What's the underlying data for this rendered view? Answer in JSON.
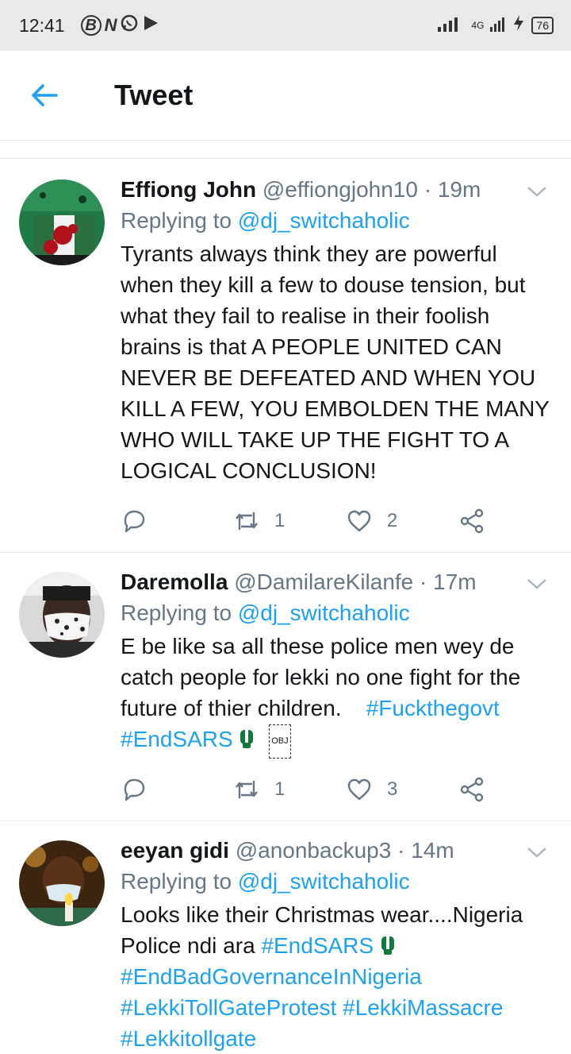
{
  "status_bar": {
    "time": "12:41",
    "network": "4G",
    "battery": "76",
    "icons": [
      "b-circle-icon",
      "n-icon",
      "whatsapp-icon",
      "play-icon",
      "signal-icon",
      "charging-icon"
    ]
  },
  "app_bar": {
    "title": "Tweet",
    "back_icon": "back-arrow-icon"
  },
  "colors": {
    "accent": "#1da1f2",
    "secondary_text": "#657786",
    "primary_text": "#14171a",
    "divider": "#e1e8ed",
    "status_bar": "#e9e9e9"
  },
  "tweets": [
    {
      "display_name": "Effiong John",
      "handle": "@effiongjohn10",
      "separator": "·",
      "time": "19m",
      "replying_prefix": "Replying to",
      "replying_to": "@dj_switchaholic",
      "text": "Tyrants always think they are powerful when they kill a few to douse tension, but what they fail to realise in their foolish brains is that A PEOPLE UNITED CAN NEVER BE DEFEATED AND WHEN YOU KILL A FEW, YOU EMBOLDEN THE MANY WHO WILL TAKE UP THE FIGHT TO A LOGICAL CONCLUSION!",
      "retweets": "1",
      "likes": "2"
    },
    {
      "display_name": "Daremolla",
      "handle": "@DamilareKilanfe",
      "separator": "·",
      "time": "17m",
      "replying_prefix": "Replying to",
      "replying_to": "@dj_switchaholic",
      "text": "E be like sa all these police men wey de catch people for lekki no one fight for the future of thier children.",
      "hashtag_1": "#Fuckthegovt",
      "hashtag_2": "#EndSARS",
      "obj_label": "OBJ",
      "retweets": "1",
      "likes": "3"
    },
    {
      "display_name": "eeyan gidi",
      "handle": "@anonbackup3",
      "separator": "·",
      "time": "14m",
      "replying_prefix": "Replying to",
      "replying_to": "@dj_switchaholic",
      "text_line_1": "Looks like their Christmas wear....Nigeria",
      "text_line_2": "Police ndi ara",
      "hashtag_1": "#EndSARS",
      "hashtag_2": "#EndBadGovernanceInNigeria",
      "hashtag_3": "#LekkiTollGateProtest",
      "hashtag_4": "#LekkiMassacre",
      "hashtag_5": "#Lekkitollgate"
    }
  ]
}
